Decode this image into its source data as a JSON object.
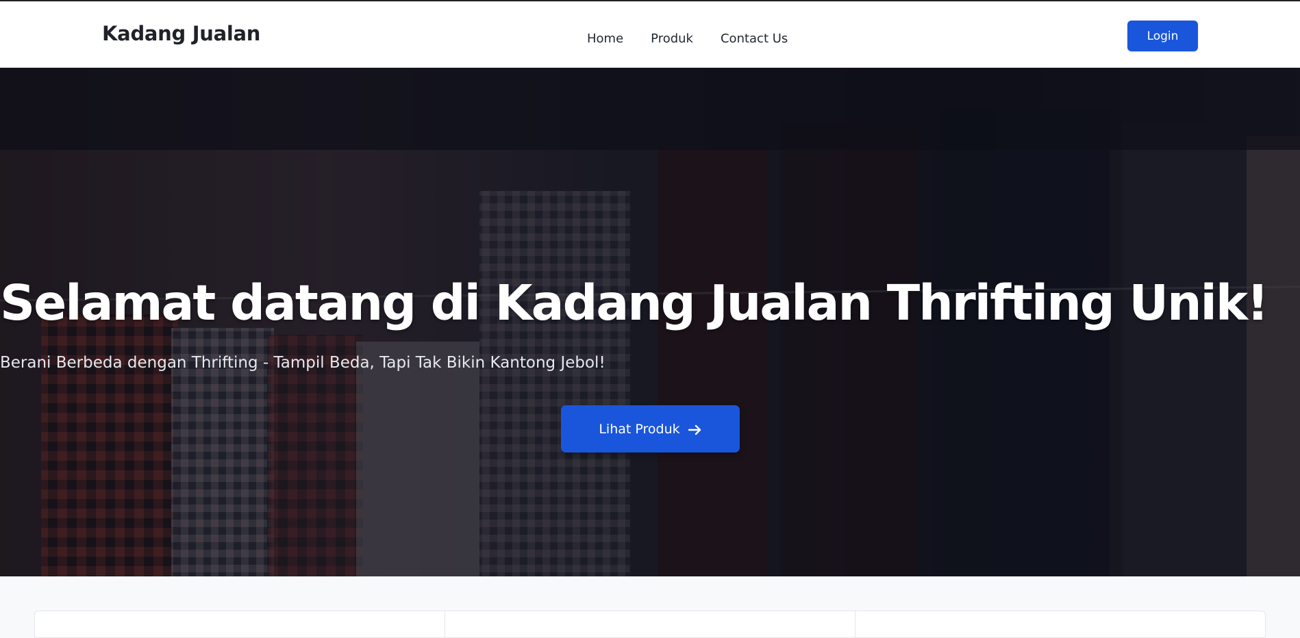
{
  "navbar": {
    "brand": "Kadang Jualan",
    "links": [
      {
        "label": "Home"
      },
      {
        "label": "Produk"
      },
      {
        "label": "Contact Us"
      }
    ],
    "login_label": "Login"
  },
  "hero": {
    "title": "Selamat datang di Kadang Jualan Thrifting Unik!",
    "subtitle": "Berani Berbeda dengan Thrifting - Tampil Beda, Tapi Tak Bikin Kantong Jebol!",
    "cta_label": "Lihat Produk",
    "cta_icon": "arrow-right-icon",
    "background_image": "clothing-rack-photo"
  },
  "colors": {
    "accent": "#1a56db",
    "brand_text": "#1f2228",
    "page_bg": "#f8f9fb"
  }
}
